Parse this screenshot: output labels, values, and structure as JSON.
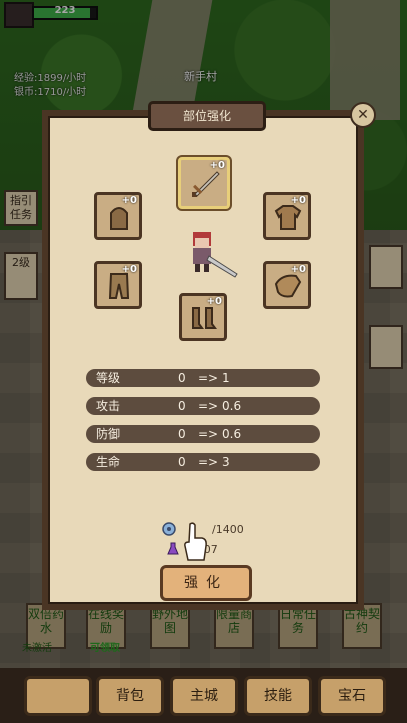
{
  "hud": {
    "hp": "223",
    "hp_fraction": 0.9,
    "exp_rate": "经验:1899/小时",
    "silver_rate": "银币:1710/小时",
    "location": "新手村"
  },
  "side_tags": {
    "guide": "指引任务",
    "level": "2级"
  },
  "modal": {
    "title": "部位强化",
    "slots": [
      {
        "name": "weapon",
        "level": "+0",
        "icon": "sword-icon"
      },
      {
        "name": "helmet",
        "level": "+0",
        "icon": "helmet-icon"
      },
      {
        "name": "armor",
        "level": "+0",
        "icon": "armor-icon"
      },
      {
        "name": "pants",
        "level": "+0",
        "icon": "pants-icon"
      },
      {
        "name": "shield",
        "level": "+0",
        "icon": "shield-icon"
      },
      {
        "name": "boots",
        "level": "+0",
        "icon": "boots-icon"
      }
    ],
    "stats": [
      {
        "label": "等级",
        "from": "0",
        "arrow": "=>",
        "to": "1"
      },
      {
        "label": "攻击",
        "from": "0",
        "arrow": "=>",
        "to": "0.6"
      },
      {
        "label": "防御",
        "from": "0",
        "arrow": "=>",
        "to": "0.6"
      },
      {
        "label": "生命",
        "from": "0",
        "arrow": "=>",
        "to": "3"
      }
    ],
    "cost1": "/1400",
    "cost2": "5/507",
    "cost2_prefix": "5",
    "enhance_label": "强化"
  },
  "functions": [
    {
      "label": "双倍药水",
      "sub": "未激活"
    },
    {
      "label": "在线奖励",
      "sub": "可领取"
    },
    {
      "label": "野外地图",
      "sub": ""
    },
    {
      "label": "限量商店",
      "sub": ""
    },
    {
      "label": "日常任务",
      "sub": ""
    },
    {
      "label": "古神契约",
      "sub": ""
    }
  ],
  "nav": {
    "items": [
      "",
      "背包",
      "主城",
      "技能",
      "宝石"
    ]
  },
  "colors": {
    "panel": "#e8d9b9",
    "border": "#4a3524",
    "stat_row": "#5d4c3e",
    "enhance": "#e3b27b",
    "hp_green": "#3fb24a",
    "func_text_green": "#1f5b16"
  }
}
